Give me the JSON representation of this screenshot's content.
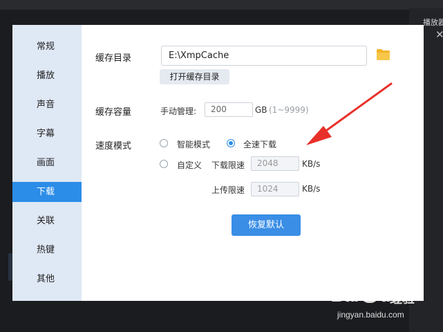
{
  "background": {
    "tab_label": "播放器"
  },
  "sidebar": {
    "items": [
      {
        "label": "常规"
      },
      {
        "label": "播放"
      },
      {
        "label": "声音"
      },
      {
        "label": "字幕"
      },
      {
        "label": "画面"
      },
      {
        "label": "下载",
        "active": true
      },
      {
        "label": "关联"
      },
      {
        "label": "热键"
      },
      {
        "label": "其他"
      }
    ]
  },
  "cache_dir": {
    "label": "缓存目录",
    "path": "E:\\XmpCache",
    "open_button": "打开缓存目录",
    "folder_icon": "folder-icon"
  },
  "cache_size": {
    "label": "缓存容量",
    "mode_label": "手动管理:",
    "value": "200",
    "unit": "GB",
    "range": "(1~9999)"
  },
  "speed_mode": {
    "label": "速度模式",
    "options": [
      {
        "label": "智能模式",
        "checked": false
      },
      {
        "label": "全速下载",
        "checked": true
      },
      {
        "label": "自定义",
        "checked": false
      }
    ],
    "download_limit_label": "下载限速",
    "download_limit_value": "2048",
    "upload_limit_label": "上传限速",
    "upload_limit_value": "1024",
    "limit_unit": "KB/s"
  },
  "restore_default_button": "恢复默认",
  "watermark": {
    "brand": "Bai",
    "brand_suffix": "du",
    "cn": "经验",
    "url": "jingyan.baidu.com"
  },
  "colors": {
    "accent": "#2c8de8",
    "arrow": "#e8302a",
    "sidebar_bg": "#dfe8f5"
  }
}
